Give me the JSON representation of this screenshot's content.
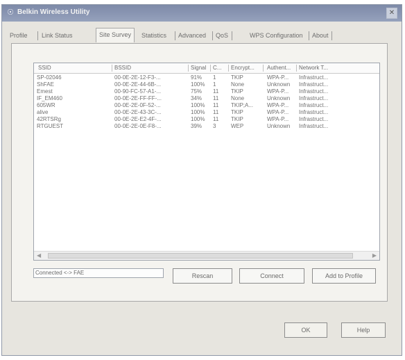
{
  "window": {
    "title": "Belkin Wireless Utility"
  },
  "tabs": [
    {
      "label": "Profile"
    },
    {
      "label": "Link Status"
    },
    {
      "label": "Site Survey"
    },
    {
      "label": "Statistics"
    },
    {
      "label": "Advanced"
    },
    {
      "label": "QoS"
    },
    {
      "label": "WPS Configuration"
    },
    {
      "label": "About"
    }
  ],
  "active_tab": "Site Survey",
  "list": {
    "columns": [
      "SSID",
      "BSSID",
      "Signal",
      "C...",
      "Encrypt...",
      "Authent...",
      "Network T..."
    ],
    "rows": [
      [
        "SP-02046",
        "00-0E-2E-12-F3-...",
        "91%",
        "1",
        "TKIP",
        "WPA-P...",
        "Infrastruct..."
      ],
      [
        "ShFAE",
        "00-0E-2E-44-6B-...",
        "100%",
        "1",
        "None",
        "Unknown",
        "Infrastruct..."
      ],
      [
        "Emest",
        "00-90-FC-57-A1-...",
        "75%",
        "11",
        "TKIP",
        "WPA-P...",
        "Infrastruct..."
      ],
      [
        "IF_EM460",
        "00-0E-2E-FF-FF-...",
        "34%",
        "11",
        "None",
        "Unknown",
        "Infrastruct..."
      ],
      [
        "605WR",
        "00-0E-2E-0F-52-...",
        "100%",
        "11",
        "TKIP;A...",
        "WPA-P...",
        "Infrastruct..."
      ],
      [
        "alive",
        "00-0E-2E-43-3C-...",
        "100%",
        "11",
        "TKIP",
        "WPA-P...",
        "Infrastruct..."
      ],
      [
        "42RTSRg",
        "00-0E-2E-E2-4F-...",
        "100%",
        "11",
        "TKIP",
        "WPA-P...",
        "Infrastruct..."
      ],
      [
        "RTGUEST",
        "00-0E-2E-0E-F8-...",
        "39%",
        "3",
        "WEP",
        "Unknown",
        "Infrastruct..."
      ]
    ]
  },
  "status": {
    "text": "Connected <-> FAE"
  },
  "buttons": {
    "rescan": "Rescan",
    "connect": "Connect",
    "add_to_profile": "Add to Profile",
    "ok": "OK",
    "help": "Help"
  },
  "icons": {
    "app": "belkin-app-icon",
    "close": "close-icon"
  }
}
